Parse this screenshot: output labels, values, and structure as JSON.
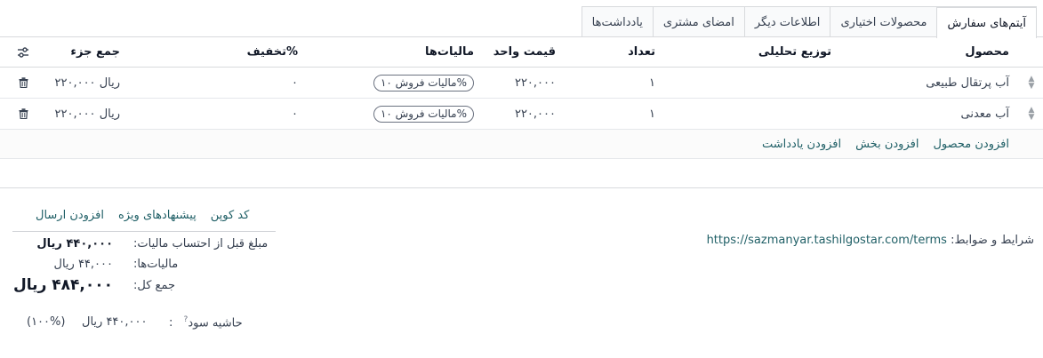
{
  "tabs": [
    {
      "label": "آیتم‌های سفارش",
      "active": true
    },
    {
      "label": "محصولات اختیاری",
      "active": false
    },
    {
      "label": "اطلاعات دیگر",
      "active": false
    },
    {
      "label": "امضای مشتری",
      "active": false
    },
    {
      "label": "یادداشت‌ها",
      "active": false
    }
  ],
  "table": {
    "headers": {
      "product": "محصول",
      "analytic": "توزیع تحلیلی",
      "quantity": "تعداد",
      "unit_price": "قیمت واحد",
      "taxes": "مالیات‌ها",
      "discount": "تخفیف%",
      "subtotal": "جمع جزء"
    },
    "rows": [
      {
        "product": "آب پرتقال طبیعی",
        "quantity": "۱",
        "unit_price": "۲۲۰,۰۰۰",
        "tax": "مالیات فروش ۱۰%",
        "discount": "۰",
        "subtotal": "۲۲۰,۰۰۰ ریال"
      },
      {
        "product": "آب معدنی",
        "quantity": "۱",
        "unit_price": "۲۲۰,۰۰۰",
        "tax": "مالیات فروش ۱۰%",
        "discount": "۰",
        "subtotal": "۲۲۰,۰۰۰ ریال"
      }
    ],
    "add_links": {
      "add_product": "افزودن محصول",
      "add_section": "افزودن بخش",
      "add_note": "افزودن یادداشت"
    }
  },
  "terms": {
    "label": "شرایط و ضوابط:",
    "url": "https://sazmanyar.tashilgostar.com/terms"
  },
  "promos": {
    "coupon": "کد کوپن",
    "offers": "پیشنهادهای ویژه",
    "shipping": "افزودن ارسال"
  },
  "totals": {
    "untaxed_label": "مبلغ قبل از احتساب مالیات:",
    "untaxed_value": "۴۴۰,۰۰۰ ریال",
    "taxes_label": "مالیات‌ها:",
    "taxes_value": "۴۴,۰۰۰ ریال",
    "total_label": "جمع کل:",
    "total_value": "۴۸۴,۰۰۰ ریال"
  },
  "margin": {
    "label": "حاشیه سود",
    "help": "?",
    "colon": ":",
    "value": "۴۴۰,۰۰۰ ریال",
    "percent": "(۱۰۰%)"
  },
  "colors": {
    "link": "#1f5f66",
    "border": "#d8dadd",
    "text": "#374151"
  }
}
